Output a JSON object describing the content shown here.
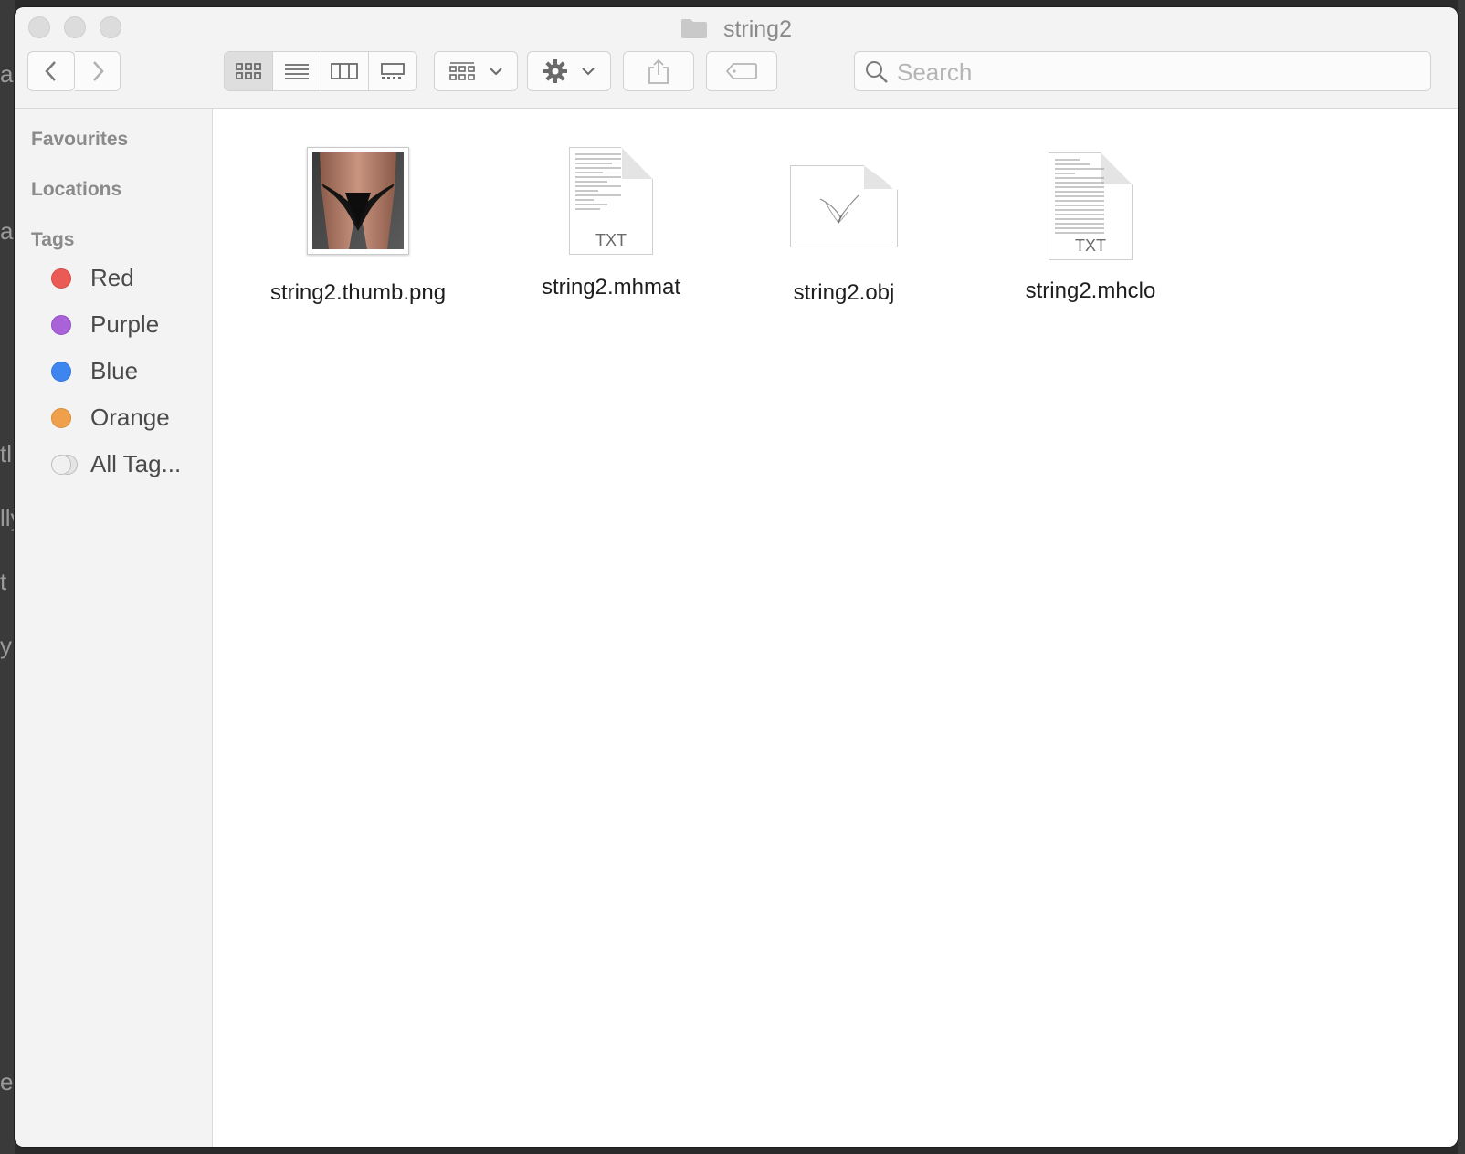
{
  "window": {
    "title": "string2"
  },
  "toolbar": {
    "search_placeholder": "Search"
  },
  "sidebar": {
    "sections": [
      "Favourites",
      "Locations",
      "Tags"
    ],
    "tags": [
      {
        "label": "Red",
        "color": "#ea5b55"
      },
      {
        "label": "Purple",
        "color": "#a962d8"
      },
      {
        "label": "Blue",
        "color": "#3f85f0"
      },
      {
        "label": "Orange",
        "color": "#f0a04b"
      },
      {
        "label": "All Tag...",
        "color": "#d4d4d4"
      }
    ]
  },
  "files": [
    {
      "name": "string2.thumb.png",
      "kind": "image"
    },
    {
      "name": "string2.mhmat",
      "kind": "text",
      "badge": "TXT"
    },
    {
      "name": "string2.obj",
      "kind": "document"
    },
    {
      "name": "string2.mhclo",
      "kind": "text",
      "badge": "TXT"
    }
  ]
}
